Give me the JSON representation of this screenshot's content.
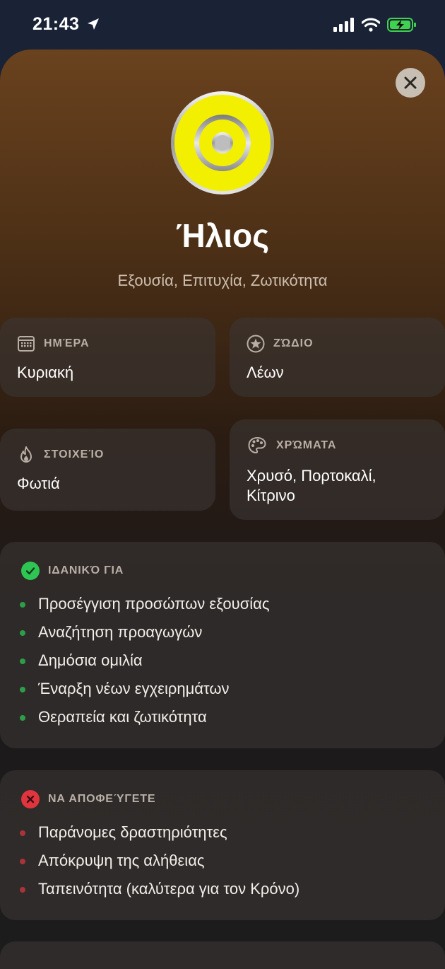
{
  "status": {
    "time": "21:43"
  },
  "planet": {
    "title": "Ήλιος",
    "subtitle": "Εξουσία, Επιτυχία, Ζωτικότητα",
    "accent": "#f2ef00"
  },
  "info": {
    "day": {
      "label": "ΗΜΈΡΑ",
      "value": "Κυριακή",
      "icon": "calendar-icon"
    },
    "zodiac": {
      "label": "ΖΏΔΙΟ",
      "value": "Λέων",
      "icon": "star-icon"
    },
    "element": {
      "label": "ΣΤΟΙΧΕΊΟ",
      "value": "Φωτιά",
      "icon": "flame-icon"
    },
    "colors": {
      "label": "ΧΡΏΜΑΤΑ",
      "value_line1": "Χρυσό, Πορτοκαλί,",
      "value_line2": "Κίτρινο",
      "icon": "palette-icon"
    }
  },
  "ideal": {
    "label": "ΙΔΑΝΙΚΌ ΓΙΑ",
    "items": [
      "Προσέγγιση προσώπων εξουσίας",
      "Αναζήτηση προαγωγών",
      "Δημόσια ομιλία",
      "Έναρξη νέων εγχειρημάτων",
      "Θεραπεία και ζωτικότητα"
    ]
  },
  "avoid": {
    "label": "ΝΑ ΑΠΟΦΕΎΓΕΤΕ",
    "items": [
      "Παράνομες δραστηριότητες",
      "Απόκρυψη της αλήθειας",
      "Ταπεινότητα (καλύτερα για τον Κρόνο)"
    ]
  }
}
